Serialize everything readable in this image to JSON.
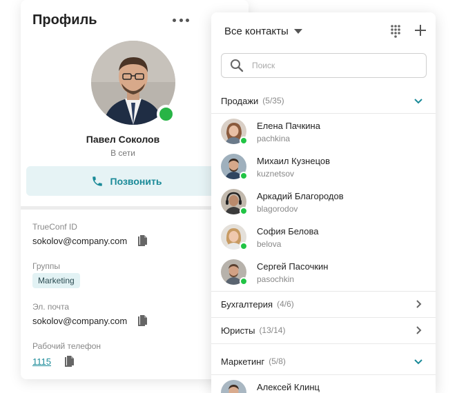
{
  "profile": {
    "title": "Профиль",
    "more_icon": "more-horizontal-icon",
    "name": "Павел Соколов",
    "status": "В сети",
    "call_label": "Позвонить",
    "status_color": "#28b446",
    "fields": {
      "trueconf_id_label": "TrueConf ID",
      "trueconf_id_value": "sokolov@company.com",
      "groups_label": "Группы",
      "group_tag": "Marketing",
      "email_label": "Эл. почта",
      "email_value": "sokolov@company.com",
      "work_phone_label": "Рабочий телефон",
      "work_phone_value": "1115"
    }
  },
  "contacts": {
    "title": "Все контакты",
    "search_placeholder": "Поиск",
    "accent_color": "#1a8a98",
    "groups": [
      {
        "name": "Продажи",
        "count": "(5/35)",
        "expanded": true
      },
      {
        "name": "Бухгалтерия",
        "count": "(4/6)",
        "expanded": false
      },
      {
        "name": "Юристы",
        "count": "(13/14)",
        "expanded": false
      },
      {
        "name": "Маркетинг",
        "count": "(5/8)",
        "expanded": true
      }
    ],
    "sales_members": [
      {
        "name": "Елена Пачкина",
        "login": "pachkina"
      },
      {
        "name": "Михаил Кузнецов",
        "login": "kuznetsov"
      },
      {
        "name": "Аркадий Благородов",
        "login": "blagorodov"
      },
      {
        "name": "София Белова",
        "login": "belova"
      },
      {
        "name": "Сергей Пасочкин",
        "login": "pasochkin"
      }
    ],
    "marketing_members": [
      {
        "name": "Алексей Клинц"
      }
    ]
  }
}
